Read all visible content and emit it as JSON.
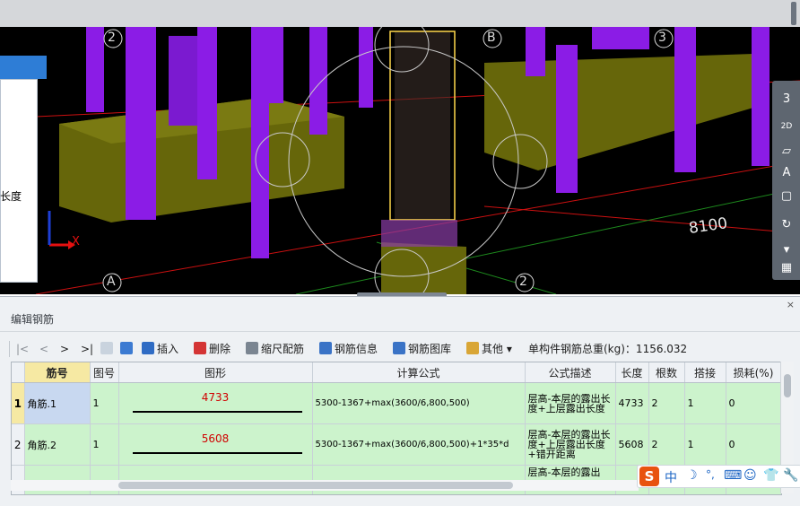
{
  "viewport": {
    "axis_labels": [
      "2",
      "B",
      "3",
      "A",
      "2",
      "A"
    ],
    "dimension": "8100",
    "x_axis": "X",
    "nav_tools": [
      "3",
      "2D",
      "",
      "A",
      "",
      "",
      "",
      ""
    ],
    "left_panel_text": "长度"
  },
  "panel": {
    "title": "编辑钢筋",
    "close": "×"
  },
  "toolbar": {
    "first": "|<",
    "prev": "<",
    "next": ">",
    "last": ">|",
    "insert": "插入",
    "delete": "删除",
    "scale": "缩尺配筋",
    "info": "钢筋信息",
    "library": "钢筋图库",
    "other": "其他",
    "other_arrow": "▾",
    "total": "单构件钢筋总重(kg)：1156.032"
  },
  "table": {
    "headers": [
      "",
      "筋号",
      "图号",
      "图形",
      "计算公式",
      "公式描述",
      "长度",
      "根数",
      "搭接",
      "损耗(%)"
    ],
    "rows": [
      {
        "idx": "1",
        "name": "角筋.1",
        "fig": "1",
        "shape_value": "4733",
        "formula": "5300-1367+max(3600/6,800,500)",
        "desc": "层高-本层的露出长度+上层露出长度",
        "length": "4733",
        "count": "2",
        "lap": "1",
        "loss": "0"
      },
      {
        "idx": "2",
        "name": "角筋.2",
        "fig": "1",
        "shape_value": "5608",
        "formula": "5300-1367+max(3600/6,800,500)+1*35*d",
        "desc": "层高-本层的露出长度+上层露出长度+错开距离",
        "length": "5608",
        "count": "2",
        "lap": "1",
        "loss": "0"
      },
      {
        "idx": "",
        "name": "",
        "fig": "",
        "shape_value": "",
        "formula": "",
        "desc": "层高-本层的露出",
        "length": "",
        "count": "",
        "lap": "",
        "loss": ""
      }
    ]
  },
  "ime": {
    "logo": "S",
    "mode": "中",
    "items": [
      "☽",
      "°,",
      "⌨",
      "☺",
      "👕",
      "🔧"
    ]
  },
  "colors": {
    "column": "#8b1ce6",
    "footing": "#6b6b00",
    "row_bg": "#ccf3cc",
    "selected_cell": "#c8d8f0",
    "active_header": "#f6e9a3"
  }
}
